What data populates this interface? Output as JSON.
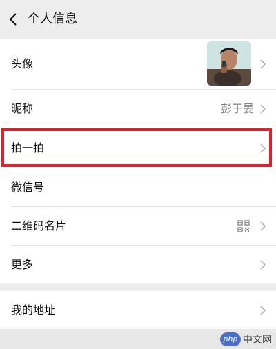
{
  "header": {
    "title": "个人信息",
    "back_icon": "chevron-left-icon"
  },
  "rows": [
    {
      "label": "头像",
      "value": "",
      "icon": "avatar-photo"
    },
    {
      "label": "昵称",
      "value": "彭于晏"
    },
    {
      "label": "拍一拍",
      "value": "",
      "highlighted": true
    },
    {
      "label": "微信号",
      "value": ""
    },
    {
      "label": "二维码名片",
      "value": "",
      "icon": "qr-code-icon"
    },
    {
      "label": "更多",
      "value": ""
    }
  ],
  "section2": {
    "rows": [
      {
        "label": "我的地址"
      }
    ]
  },
  "watermark": {
    "badge": "php",
    "text": "中文网"
  },
  "colors": {
    "highlight": "#d9232d",
    "background": "#ededed",
    "row_background": "#ffffff"
  }
}
